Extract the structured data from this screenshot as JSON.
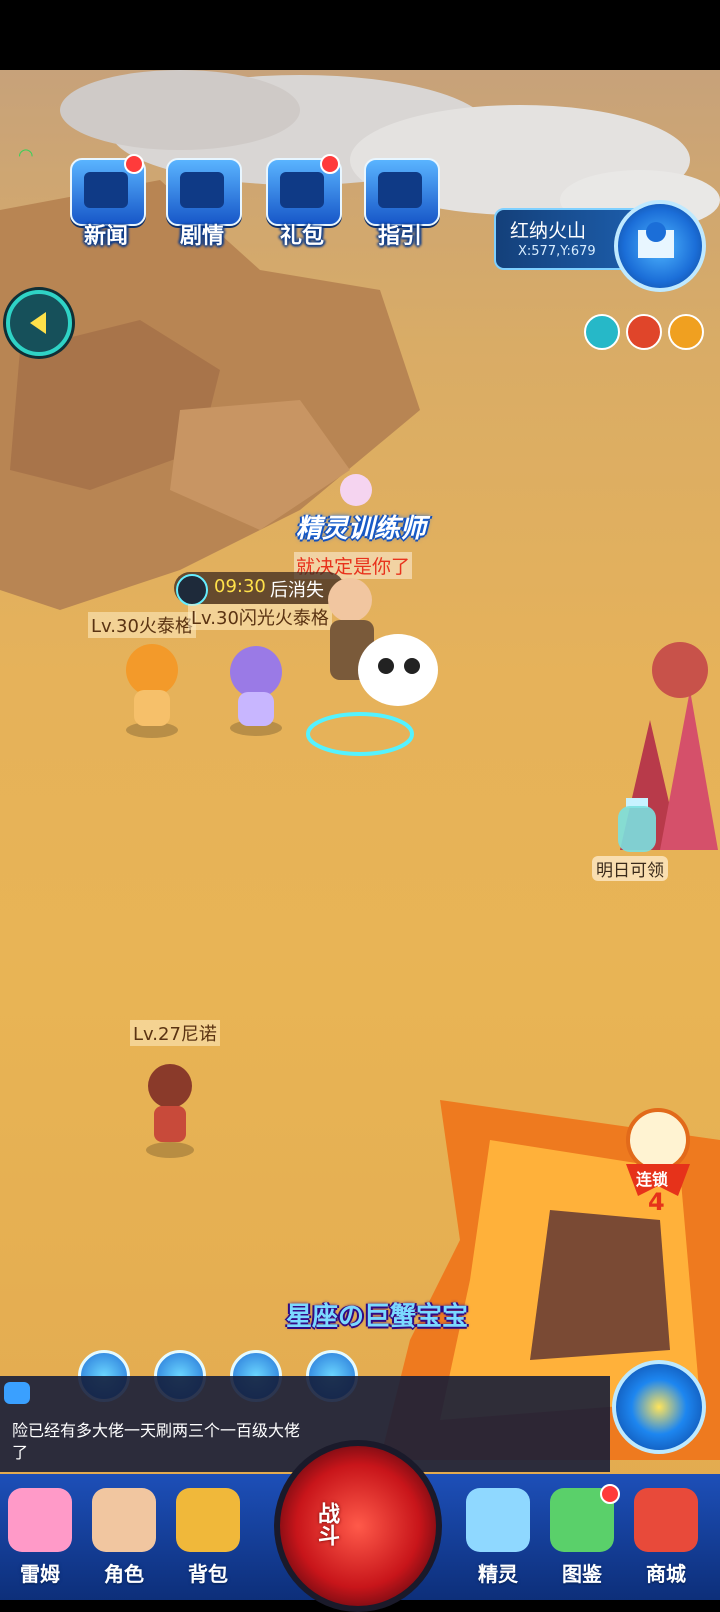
{
  "status_bar": {
    "background": "#000000"
  },
  "top_menu": [
    {
      "label": "新闻",
      "has_badge": true
    },
    {
      "label": "剧情",
      "has_badge": false
    },
    {
      "label": "礼包",
      "has_badge": true
    },
    {
      "label": "指引",
      "has_badge": false
    }
  ],
  "location": {
    "name": "红纳火山",
    "coords": "X:577,Y:679"
  },
  "player": {
    "title": "精灵训练师",
    "shout": "就决定是你了",
    "timer_value": "09:30",
    "timer_suffix": "后消失"
  },
  "npcs": [
    {
      "label": "Lv.30火泰格"
    },
    {
      "label": "Lv.30闪光火泰格"
    },
    {
      "label": "Lv.27尼诺"
    }
  ],
  "bottle_label": "明日可领",
  "combo": {
    "label": "连锁",
    "count": "4"
  },
  "event_banner": "星座の巨蟹宝宝",
  "chat": {
    "message": "险已经有多大佬一天刷两三个一百级大佬了"
  },
  "bottom_nav": [
    {
      "label": "雷姆"
    },
    {
      "label": "角色"
    },
    {
      "label": "背包"
    },
    {
      "label": "精灵"
    },
    {
      "label": "图鉴",
      "has_badge": true
    },
    {
      "label": "商城"
    }
  ],
  "battle_button": {
    "label": "战斗"
  },
  "colors": {
    "accent": "#1d86f0",
    "badge": "#ff3b3b",
    "timer": "#ffe14a",
    "shout": "#e8321c"
  }
}
